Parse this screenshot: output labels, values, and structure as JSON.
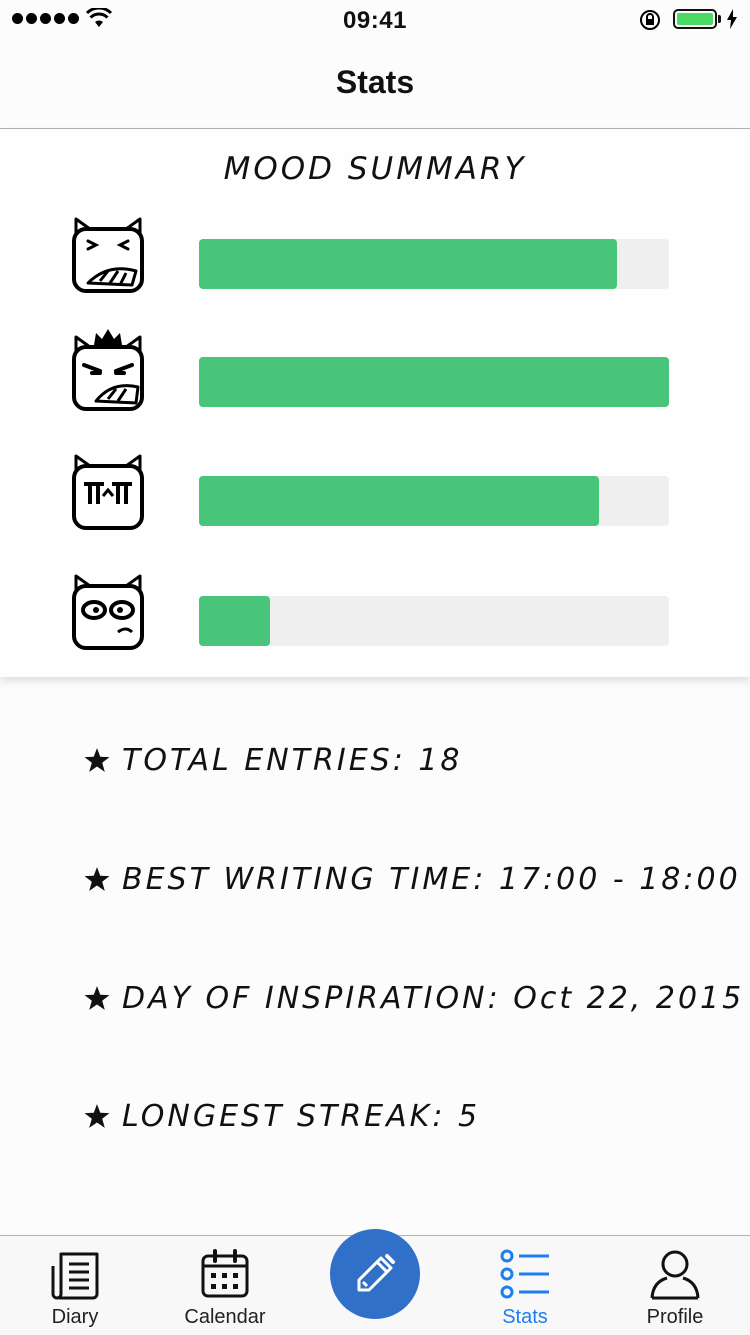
{
  "status_bar": {
    "time": "09:41",
    "battery_color": "#4cd964"
  },
  "nav": {
    "title": "Stats"
  },
  "mood_summary": {
    "title": "MOOD SUMMARY",
    "bar_color": "#48c57a",
    "track_color": "#efefef",
    "moods": [
      {
        "icon": "laughing-cat-face-icon",
        "level": 0.89
      },
      {
        "icon": "crowned-angry-cat-face-icon",
        "level": 1.0
      },
      {
        "icon": "crying-cat-face-icon",
        "level": 0.85
      },
      {
        "icon": "shocked-cat-face-icon",
        "level": 0.15
      }
    ]
  },
  "stats": [
    {
      "icon": "star-icon",
      "text": "TOTAL ENTRIES: 18"
    },
    {
      "icon": "star-icon",
      "text": "BEST WRITING TIME: 17:00 - 18:00"
    },
    {
      "icon": "star-icon",
      "text": "DAY OF INSPIRATION: Oct 22, 2015"
    },
    {
      "icon": "star-icon",
      "text": "LONGEST STREAK: 5"
    }
  ],
  "tab_bar": {
    "accent_color": "#1d7ef0",
    "compose_color": "#3170c9",
    "tabs": [
      {
        "label": "Diary",
        "icon": "diary-icon"
      },
      {
        "label": "Calendar",
        "icon": "calendar-icon"
      },
      {
        "label": "Stats",
        "icon": "stats-list-icon",
        "active": true
      },
      {
        "label": "Profile",
        "icon": "profile-icon"
      }
    ],
    "compose_icon": "pencil-icon"
  }
}
